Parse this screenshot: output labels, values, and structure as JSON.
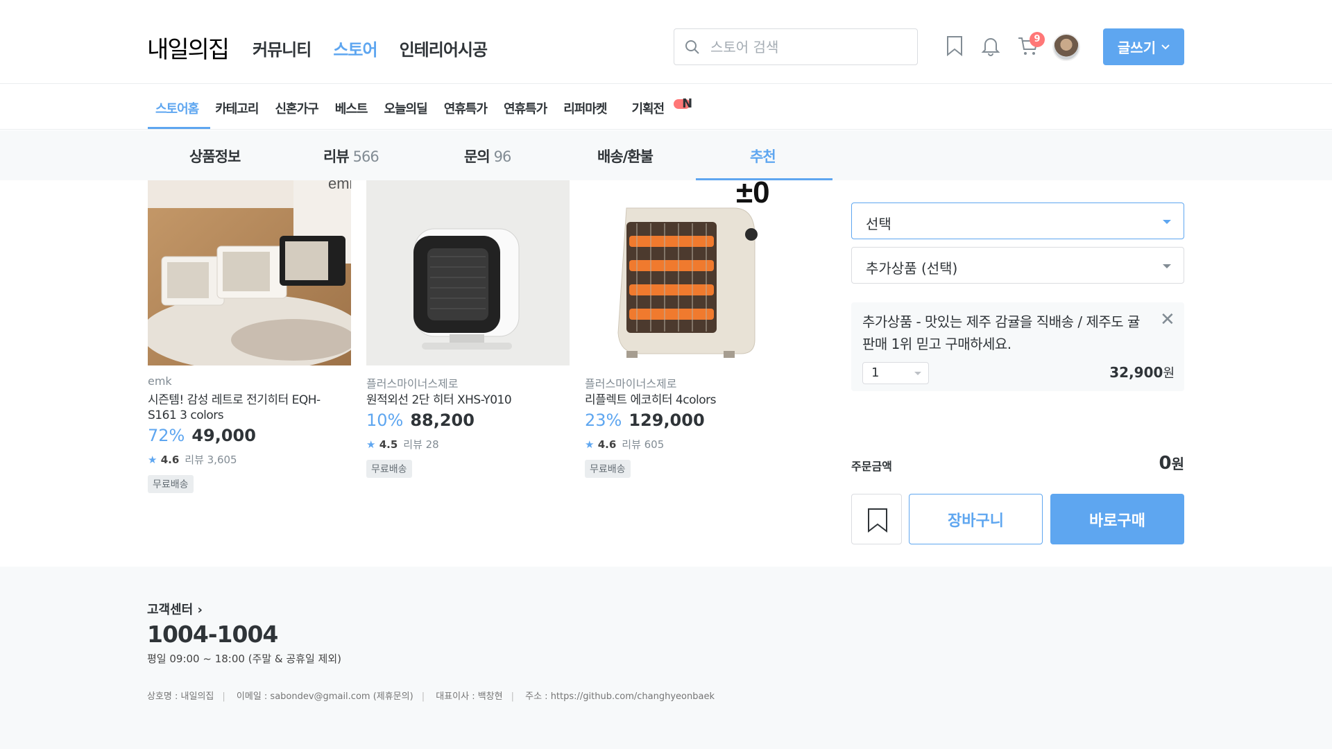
{
  "header": {
    "logo": "내일의집",
    "nav": [
      "커뮤니티",
      "스토어",
      "인테리어시공"
    ],
    "search_placeholder": "스토어 검색",
    "cart_count": "9",
    "write_label": "글쓰기",
    "accent_color": "#5ea6f0"
  },
  "subnav": {
    "items": [
      "스토어홈",
      "카테고리",
      "신혼가구",
      "베스트",
      "오늘의딜",
      "연휴특가",
      "연휴특가",
      "리퍼마켓",
      "기획전"
    ],
    "new_badge": "N"
  },
  "tabs": [
    {
      "label": "상품정보",
      "count": ""
    },
    {
      "label": "리뷰",
      "count": "566"
    },
    {
      "label": "문의",
      "count": "96"
    },
    {
      "label": "배송/환불",
      "count": ""
    },
    {
      "label": "추천",
      "count": ""
    }
  ],
  "products": [
    {
      "brand": "emk",
      "name": "시즌템! 감성 레트로 전기히터 EQH-S161 3 colors",
      "discount": "72%",
      "price": "49,000",
      "rating": "4.6",
      "reviews": "리뷰 3,605",
      "tag": "무료배송",
      "image_mark": "emk"
    },
    {
      "brand": "플러스마이너스제로",
      "name": "원적외선 2단 히터 XHS-Y010",
      "discount": "10%",
      "price": "88,200",
      "rating": "4.5",
      "reviews": "리뷰 28",
      "tag": "무료배송"
    },
    {
      "brand": "플러스마이너스제로",
      "name": "리플렉트 에코히터 4colors",
      "discount": "23%",
      "price": "129,000",
      "rating": "4.6",
      "reviews": "리뷰 605",
      "tag": "무료배송",
      "image_mark": "±0"
    }
  ],
  "order": {
    "select_label": "선택",
    "extra_select_label": "추가상품 (선택)",
    "added_item_desc": "추가상품 - 맛있는 제주 감귤을 직배송 / 제주도 귤 판매 1위 믿고 구매하세요.",
    "added_qty": "1",
    "added_price": "32,900",
    "currency": "원",
    "total_label": "주문금액",
    "total_value": "0",
    "cart_label": "장바구니",
    "buy_label": "바로구매"
  },
  "footer": {
    "cs_title": "고객센터 ›",
    "cs_phone": "1004-1004",
    "cs_hours": "평일 09:00 ~ 18:00 (주말 & 공휴일 제외)",
    "biz": [
      "상호명 : 내일의집",
      "이메일 : sabondev@gmail.com (제휴문의)",
      "대표이사 : 백창현",
      "주소 : https://github.com/changhyeonbaek"
    ]
  }
}
